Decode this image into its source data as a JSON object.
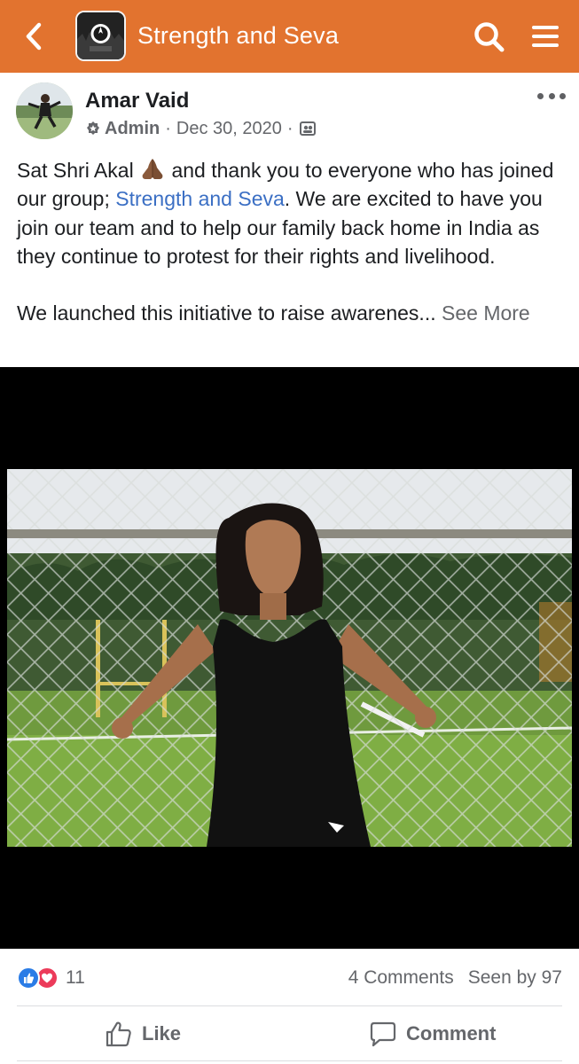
{
  "header": {
    "title": "Strength and Seva",
    "back_icon": "chevron-left-icon",
    "search_icon": "search-icon",
    "menu_icon": "hamburger-menu-icon",
    "bar_color": "#e2732f"
  },
  "post": {
    "author": "Amar Vaid",
    "role": "Admin",
    "date": "Dec 30, 2020",
    "privacy_icon": "members-only-icon",
    "more_icon": "more-options-icon",
    "text": {
      "p1_before_emoji": "Sat Shri Akal",
      "p1_emoji": "folded-hands-emoji",
      "p1_after_emoji": " and thank you to everyone who has joined our group; ",
      "p1_link": "Strength and Seva",
      "p1_end": ". We are excited to have you join our team and to help our family back home in India as they continue to protest for their rights and livelihood.",
      "p2": "We launched this initiative to raise awarenes...",
      "see_more": "See More"
    }
  },
  "stats": {
    "reaction_icons": [
      "like-reaction-icon",
      "love-reaction-icon"
    ],
    "reaction_count": "11",
    "comments": "4 Comments",
    "seen_by": "Seen by 97"
  },
  "actions": {
    "like": "Like",
    "comment": "Comment"
  },
  "colors": {
    "accent": "#e2732f",
    "link": "#3b6fc4",
    "like_blue": "#2a7ce6",
    "love_red": "#ec3b5a"
  }
}
